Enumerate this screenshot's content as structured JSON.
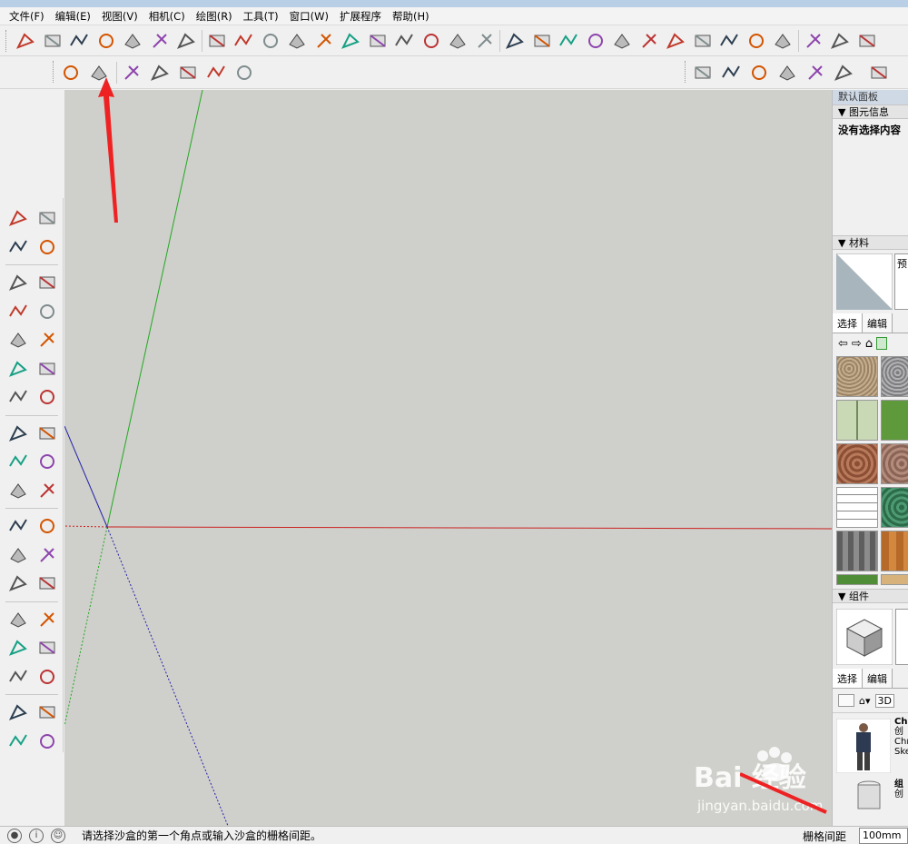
{
  "menu": [
    "文件(F)",
    "编辑(E)",
    "视图(V)",
    "相机(C)",
    "绘图(R)",
    "工具(T)",
    "窗口(W)",
    "扩展程序",
    "帮助(H)"
  ],
  "toolbar_icons": {
    "row1": [
      "sandbox-from-contours-icon",
      "sandbox-from-scratch-icon",
      "smoove-icon",
      "stamp-icon",
      "drape-icon",
      "add-detail-icon",
      "flip-edge-icon",
      "solid-union-icon",
      "solid-subtract-icon",
      "freehand-icon",
      "arc-icon",
      "curve-icon",
      "follow-me-icon",
      "offset-icon",
      "push-pull-icon",
      "shape-bender-icon",
      "curviloft-icon",
      "round-corner-icon",
      "fillet-icon",
      "extrude-icon",
      "ruby-console-icon",
      "section-icon",
      "export-icon",
      "camera-icon",
      "warehouse-icon",
      "component-icon",
      "layout-icon",
      "style-icon",
      "pen-icon",
      "3b-icon",
      "rss-icon",
      "su-app-icon"
    ],
    "row2_left": [
      "sandbox-contours-icon",
      "sandbox-grid-icon",
      "smoove-terrain-icon",
      "stamp-terrain-icon",
      "drape-terrain-icon",
      "add-detail-terrain-icon",
      "flip-edge-terrain-icon"
    ],
    "row2_right": [
      "iso-view-icon",
      "top-view-icon",
      "front-view-icon",
      "right-view-icon",
      "back-view-icon",
      "left-view-icon",
      "layers-icon"
    ]
  },
  "right_panel": {
    "title": "默认面板",
    "entity_info": {
      "header": "图元信息",
      "text": "没有选择内容"
    },
    "materials": {
      "header": "材料",
      "preview_label": "预",
      "tabs": [
        "选择",
        "编辑"
      ]
    },
    "components": {
      "header": "组件",
      "tabs": [
        "选择",
        "编辑"
      ],
      "dropdown": "3D",
      "items": [
        {
          "name": "Ch",
          "line1": "创",
          "line2": "Chr",
          "line3": "Ske"
        },
        {
          "name": "组",
          "line1": "创"
        }
      ]
    }
  },
  "status": {
    "message": "请选择沙盒的第一个角点或输入沙盒的栅格间距。",
    "vcb_label": "栅格间距",
    "vcb_value": "100mm"
  },
  "watermark": {
    "brand": "Bai 经验",
    "url": "jingyan.baidu.com"
  },
  "colors": {
    "viewport_bg": "#cfcfcb",
    "axis_red": "#cc2222",
    "axis_green": "#22aa22",
    "axis_blue": "#2222aa",
    "annotation_arrow": "#ee2222"
  }
}
